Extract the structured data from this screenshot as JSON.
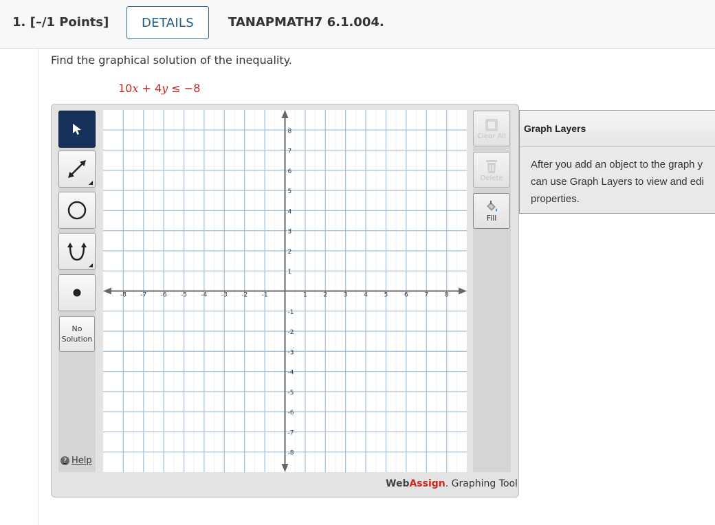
{
  "header": {
    "question_number": "1.  [–/1 Points]",
    "details_label": "DETAILS",
    "question_code": "TANAPMATH7 6.1.004."
  },
  "question": {
    "prompt": "Find the graphical solution of the inequality.",
    "ineq_coef_x": "10",
    "ineq_var_x": "x",
    "ineq_plus": " + 4",
    "ineq_var_y": "y",
    "ineq_rel": " ≤ −8"
  },
  "tools": {
    "items": [
      {
        "name": "pointer-tool",
        "icon": "arrow-pointer-icon",
        "active": true
      },
      {
        "name": "line-tool",
        "icon": "double-arrow-line-icon",
        "active": false
      },
      {
        "name": "circle-tool",
        "icon": "circle-icon",
        "active": false
      },
      {
        "name": "parabola-tool",
        "icon": "parabola-icon",
        "active": false
      },
      {
        "name": "point-tool",
        "icon": "point-icon",
        "active": false
      }
    ],
    "no_solution_line1": "No",
    "no_solution_line2": "Solution",
    "help_label": "Help"
  },
  "graph": {
    "x_ticks": [
      -8,
      -7,
      -6,
      -5,
      -4,
      -3,
      -2,
      -1,
      1,
      2,
      3,
      4,
      5,
      6,
      7,
      8
    ],
    "y_ticks": [
      8,
      7,
      6,
      5,
      4,
      3,
      2,
      1,
      -1,
      -2,
      -3,
      -4,
      -5,
      -6,
      -7,
      -8
    ],
    "xlim": [
      -9,
      9
    ],
    "ylim": [
      -9,
      9
    ],
    "grid": true,
    "grid_color": "#a9c4dc",
    "axis_color": "#666666"
  },
  "actions": {
    "clear_all_label": "Clear All",
    "delete_label": "Delete",
    "fill_label": "Fill"
  },
  "branding": {
    "web": "Web",
    "assign": "Assign",
    "suffix": ". Graphing Tool"
  },
  "layers_panel": {
    "title": "Graph Layers",
    "line1": "After you add an object to the graph y",
    "line2": "can use Graph Layers to view and edi",
    "line3": "properties."
  }
}
